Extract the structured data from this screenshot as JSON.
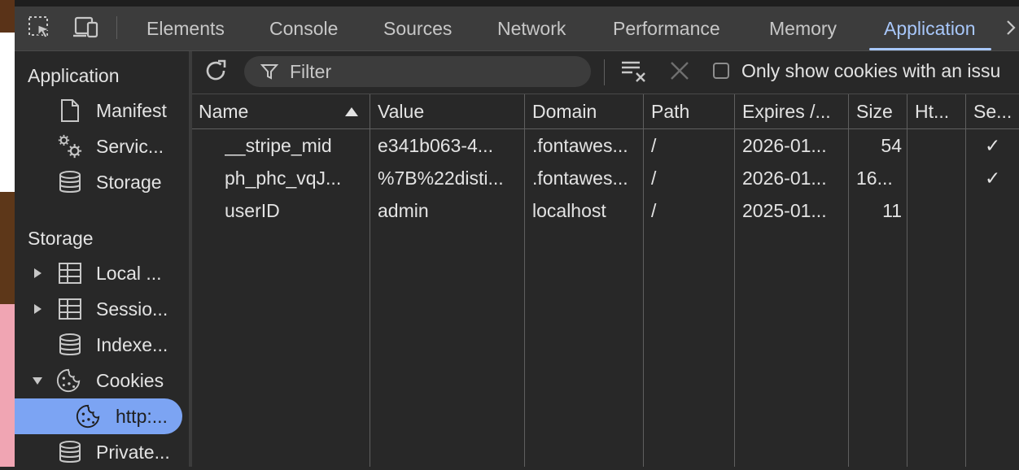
{
  "devtools": {
    "tabs": [
      {
        "label": "Elements"
      },
      {
        "label": "Console"
      },
      {
        "label": "Sources"
      },
      {
        "label": "Network"
      },
      {
        "label": "Performance"
      },
      {
        "label": "Memory"
      },
      {
        "label": "Application"
      }
    ],
    "active_tab": "Application",
    "more_tabs_icon": "chevron-right-icon",
    "accent_color": "#a8c7fa"
  },
  "sidebar": {
    "application_heading": "Application",
    "application_items": [
      {
        "label": "Manifest",
        "icon": "document-icon"
      },
      {
        "label": "Servic...",
        "icon": "gears-icon"
      },
      {
        "label": "Storage",
        "icon": "database-icon"
      }
    ],
    "storage_heading": "Storage",
    "storage_items": [
      {
        "label": "Local ...",
        "icon": "table-icon",
        "expander": "collapsed"
      },
      {
        "label": "Sessio...",
        "icon": "table-icon",
        "expander": "collapsed"
      },
      {
        "label": "Indexe...",
        "icon": "database-icon",
        "expander": "none"
      },
      {
        "label": "Cookies",
        "icon": "cookie-icon",
        "expander": "expanded"
      },
      {
        "label": "http:...",
        "icon": "cookie-icon",
        "expander": "none",
        "selected": true
      },
      {
        "label": "Private...",
        "icon": "database-icon",
        "expander": "none"
      }
    ],
    "selected_color": "#7ca4f3"
  },
  "toolbar": {
    "filter_placeholder": "Filter",
    "only_issues_label": "Only show cookies with an issu",
    "only_issues_checked": false
  },
  "cookies_table": {
    "columns": [
      "Name",
      "Value",
      "Domain",
      "Path",
      "Expires /...",
      "Size",
      "Ht...",
      "Se..."
    ],
    "sorted_column": "Name",
    "sort_direction": "ascending",
    "rows": [
      {
        "name": "__stripe_mid",
        "value": "e341b063-4...",
        "domain": ".fontawes...",
        "path": "/",
        "expires": "2026-01...",
        "size": "54",
        "http_only": "",
        "secure": "✓"
      },
      {
        "name": "ph_phc_vqJ...",
        "value": "%7B%22disti...",
        "domain": ".fontawes...",
        "path": "/",
        "expires": "2026-01...",
        "size": "16...",
        "http_only": "",
        "secure": "✓"
      },
      {
        "name": "userID",
        "value": "admin",
        "domain": "localhost",
        "path": "/",
        "expires": "2025-01...",
        "size": "11",
        "http_only": "",
        "secure": ""
      }
    ]
  }
}
